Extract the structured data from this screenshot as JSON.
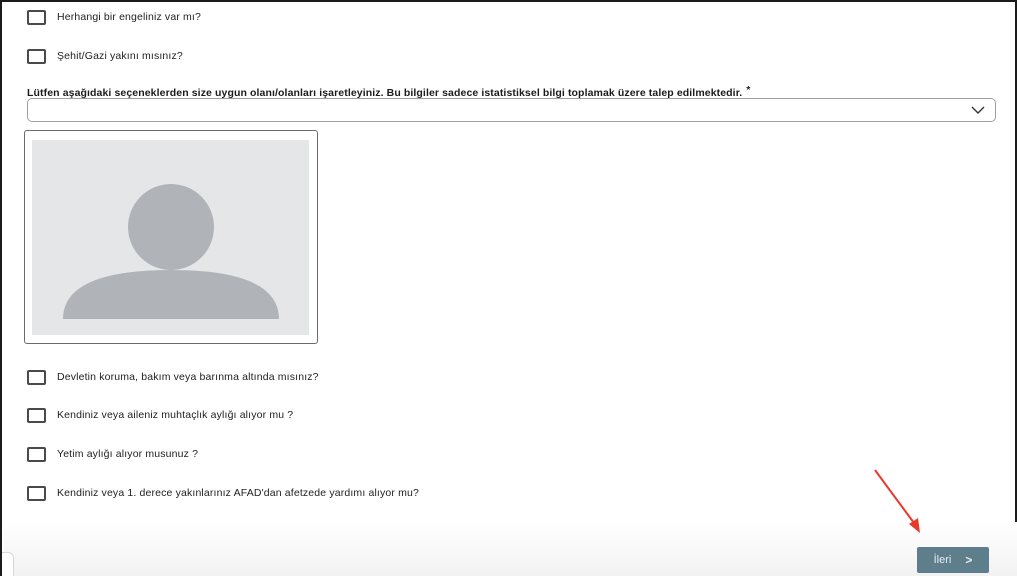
{
  "form": {
    "checkboxes_top": [
      {
        "label": "Herhangi bir engeliniz var mı?"
      },
      {
        "label": "Şehit/Gazi yakını mısınız?"
      }
    ],
    "question": {
      "text": "Lütfen aşağıdaki seçeneklerden size uygun olanı/olanları işaretleyiniz. Bu bilgiler sadece istatistiksel bilgi toplamak üzere talep edilmektedir.",
      "required_mark": "*"
    },
    "select": {
      "value": "",
      "icon": "chevron-down-icon"
    },
    "photo": {
      "icon": "person-placeholder-icon"
    },
    "checkboxes_bottom": [
      {
        "label": "Devletin koruma, bakım veya barınma altında mısınız?"
      },
      {
        "label": "Kendiniz veya aileniz muhtaçlık aylığı alıyor mu ?"
      },
      {
        "label": "Yetim aylığı alıyor musunuz ?"
      },
      {
        "label": "Kendiniz veya 1. derece yakınlarınız AFAD'dan afetzede yardımı alıyor mu?"
      }
    ]
  },
  "footer": {
    "next_label": "İleri",
    "next_icon_glyph": ">"
  },
  "colors": {
    "next_button": "#5f7e8c",
    "annotation_arrow": "#e8392a",
    "avatar_bg": "#e5e6e8",
    "avatar_figure": "#b0b4b8"
  }
}
